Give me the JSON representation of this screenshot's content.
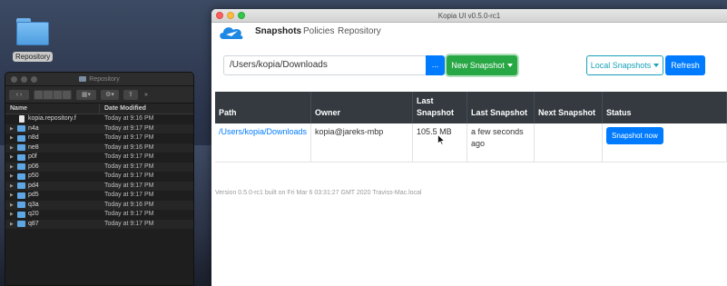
{
  "desktop": {
    "icon_label": "Repository"
  },
  "finder": {
    "title": "Repository",
    "columns": {
      "name": "Name",
      "date": "Date Modified"
    },
    "rows": [
      {
        "name": "kopia.repository.f",
        "date": "Today at 9:16 PM",
        "kind": "file"
      },
      {
        "name": "n4a",
        "date": "Today at 9:17 PM",
        "kind": "folder"
      },
      {
        "name": "n8d",
        "date": "Today at 9:17 PM",
        "kind": "folder"
      },
      {
        "name": "ne8",
        "date": "Today at 9:16 PM",
        "kind": "folder"
      },
      {
        "name": "p0f",
        "date": "Today at 9:17 PM",
        "kind": "folder"
      },
      {
        "name": "p06",
        "date": "Today at 9:17 PM",
        "kind": "folder"
      },
      {
        "name": "p50",
        "date": "Today at 9:17 PM",
        "kind": "folder"
      },
      {
        "name": "pd4",
        "date": "Today at 9:17 PM",
        "kind": "folder"
      },
      {
        "name": "pd5",
        "date": "Today at 9:17 PM",
        "kind": "folder"
      },
      {
        "name": "q3a",
        "date": "Today at 9:16 PM",
        "kind": "folder"
      },
      {
        "name": "q20",
        "date": "Today at 9:17 PM",
        "kind": "folder"
      },
      {
        "name": "q87",
        "date": "Today at 9:17 PM",
        "kind": "folder"
      }
    ]
  },
  "kopia": {
    "window_title": "Kopia UI v0.5.0-rc1",
    "nav": {
      "snapshots": "Snapshots",
      "policies": "Policies",
      "repository": "Repository"
    },
    "path_value": "/Users/kopia/Downloads",
    "browse_label": "...",
    "new_snapshot_label": "New Snapshot",
    "local_snapshots_label": "Local Snapshots",
    "refresh_label": "Refresh",
    "table": {
      "headers": {
        "path": "Path",
        "owner": "Owner",
        "last_snapshot_1": "Last",
        "last_snapshot_2": "Snapshot",
        "last_snapshot_time": "Last Snapshot",
        "next_snapshot": "Next Snapshot",
        "status": "Status"
      },
      "row": {
        "path": "/Users/kopia/Downloads",
        "owner": "kopia@jareks-mbp",
        "size": "105.5 MB",
        "last_snapshot": "a few seconds ago",
        "next_snapshot": "",
        "status_button": "Snapshot now"
      }
    },
    "version_text": "Version 0.5.0-rc1 built on Fri Mar 6 03:31:27 GMT 2020 Traviss-Mac.local",
    "colors": {
      "primary": "#007bff",
      "success": "#28a745",
      "info": "#17a2b8",
      "table_header": "#343a40"
    }
  }
}
